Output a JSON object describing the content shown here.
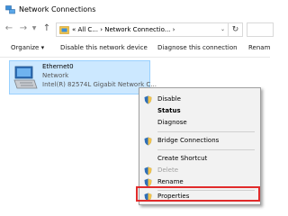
{
  "window": {
    "title": "Network Connections"
  },
  "address": {
    "path": "« All C... › Network Connectio... ›"
  },
  "toolbar": {
    "organize": "Organize ▾",
    "disable": "Disable this network device",
    "diagnose": "Diagnose this connection",
    "rename": "Renam"
  },
  "connection": {
    "name": "Ethernet0",
    "network": "Network",
    "adapter": "Intel(R) 82574L Gigabit Network C..."
  },
  "context_menu": {
    "items": [
      {
        "label": "Disable",
        "icon": "shield-icon"
      },
      {
        "label": "Status"
      },
      {
        "label": "Diagnose"
      },
      {
        "label": "Bridge Connections",
        "icon": "shield-icon"
      },
      {
        "label": "Create Shortcut"
      },
      {
        "label": "Delete",
        "icon": "shield-icon",
        "disabled": true
      },
      {
        "label": "Rename",
        "icon": "shield-icon"
      },
      {
        "label": "Properties",
        "icon": "shield-icon"
      }
    ]
  },
  "colors": {
    "selection": "#cce8ff",
    "highlight_box": "#e12b2b",
    "menu_background": "#f2f2f2"
  }
}
